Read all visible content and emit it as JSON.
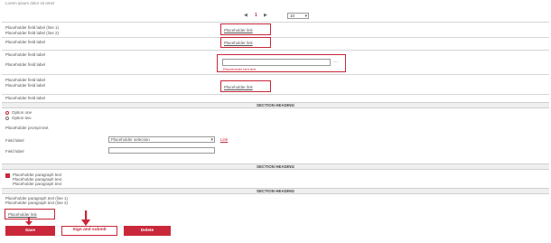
{
  "header": {
    "note": "Lorem ipsum dolor sit amet"
  },
  "pager": {
    "prev": "◀",
    "current": "1",
    "next": "▶",
    "per_page": "10"
  },
  "rows": {
    "r1_label": "Placeholder field label (line 1)",
    "r1_label2": "Placeholder field label (line 2)",
    "r1_link": "Placeholder link",
    "r2_label": "Placeholder field label",
    "r2_link": "Placeholder link",
    "r3_label": "Placeholder field label",
    "r4_label": "Placeholder field label",
    "r4_hint": "Placeholder hint text",
    "r4_btn": "…",
    "r5_label": "Placeholder field label",
    "r5_label2": "Placeholder field label",
    "r5_link": "Placeholder link",
    "r6_label": "Placeholder field label"
  },
  "section_delivery": {
    "title": "SECTION HEADING",
    "opt1": "Option one",
    "opt2": "Option two",
    "prompt": "Placeholder prompt text",
    "field1_label": "Field label",
    "select_value": "Placeholder selection",
    "field1_link": "Link",
    "field2_label": "Field label"
  },
  "section_info": {
    "title": "SECTION HEADING",
    "text1": "Placeholder paragraph text",
    "text2": "Placeholder paragraph text",
    "text3": "Placeholder paragraph text"
  },
  "section_sign": {
    "title": "SECTION HEADING",
    "text1": "Placeholder paragraph text (line 1)",
    "text2": "Placeholder paragraph text (line 2)",
    "link": "Placeholder link"
  },
  "buttons": {
    "save": "Save",
    "sign_send": "Sign and submit",
    "delete": "Delete"
  },
  "colors": {
    "accent": "#c8283a"
  }
}
